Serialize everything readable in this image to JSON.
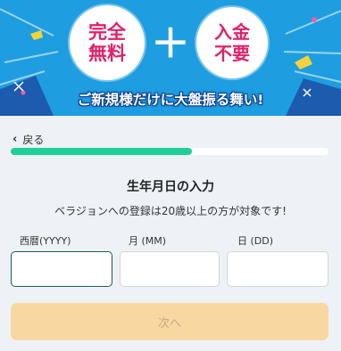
{
  "banner": {
    "badge_left": {
      "line1": "完全",
      "line2": "無料"
    },
    "plus": "＋",
    "badge_right": {
      "line1": "入金",
      "line2": "不要"
    },
    "tagline": "ご新規様だけに大盤振る舞い!",
    "colors": {
      "background": "#1e9ee0",
      "badge_text": "#e0206a"
    }
  },
  "nav": {
    "back_label": "戻る",
    "back_icon": "chevron-left-icon"
  },
  "progress": {
    "value": 0.57,
    "fill_color": "#1fcf99"
  },
  "form": {
    "title": "生年月日の入力",
    "subtitle": "ベラジョンへの登録は20歳以上の方が対象です!",
    "fields": {
      "year_label": "西暦(YYYY)",
      "month_label": "月 (MM)",
      "day_label": "日 (DD)",
      "year_value": "",
      "month_value": "",
      "day_value": ""
    },
    "next_label": "次へ",
    "next_color": "#f8d8a0"
  }
}
